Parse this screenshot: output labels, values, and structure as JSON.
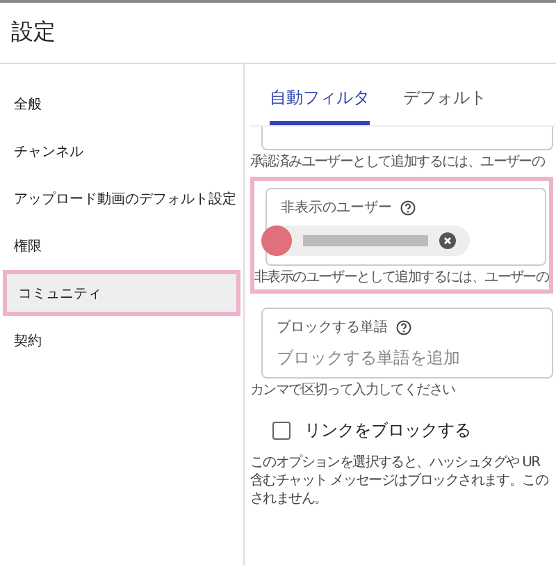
{
  "window": {
    "title": "設定"
  },
  "sidebar": {
    "items": [
      {
        "label": "全般",
        "selected": false,
        "highlighted": false
      },
      {
        "label": "チャンネル",
        "selected": false,
        "highlighted": false
      },
      {
        "label": "アップロード動画のデフォルト設定",
        "selected": false,
        "highlighted": false
      },
      {
        "label": "権限",
        "selected": false,
        "highlighted": false
      },
      {
        "label": "コミュニティ",
        "selected": true,
        "highlighted": true
      },
      {
        "label": "契約",
        "selected": false,
        "highlighted": false
      }
    ]
  },
  "tabs": [
    {
      "label": "自動フィルタ",
      "selected": true
    },
    {
      "label": "デフォルト",
      "selected": false
    }
  ],
  "approved_users": {
    "helper": "承認済みユーザーとして追加するには、ユーザーの"
  },
  "hidden_users": {
    "label": "非表示のユーザー",
    "highlighted": true,
    "helper": "非表示のユーザーとして追加するには、ユーザーの"
  },
  "blocked_words": {
    "label": "ブロックする単語",
    "placeholder": "ブロックする単語を追加",
    "helper": "カンマで区切って入力してください"
  },
  "block_links": {
    "label": "リンクをブロックする",
    "checked": false,
    "description_lines": [
      "このオプションを選択すると、ハッシュタグや UR",
      "含むチャット メッセージはブロックされます。この",
      "されません。"
    ]
  }
}
